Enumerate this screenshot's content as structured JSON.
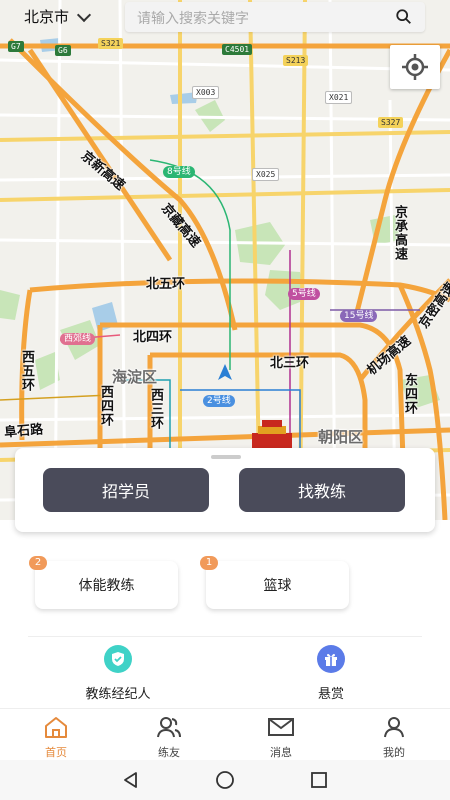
{
  "header": {
    "city": "北京市",
    "search_placeholder": "请输入搜索关键字"
  },
  "map": {
    "road_labels": {
      "jingxin": "京新高速",
      "jingzang": "京藏高速",
      "jingcheng": "京承高速",
      "jingmi": "京密高速",
      "jichang": "机场高速",
      "north5": "北五环",
      "north4": "北四环",
      "north3": "北三环",
      "west5": "西五环",
      "west4": "西四环",
      "west3": "西三环",
      "east4": "东四环",
      "fushi": "阜石路"
    },
    "district_labels": {
      "haidian": "海淀区",
      "chaoyang": "朝阳区"
    },
    "road_badges": {
      "g7": "G7",
      "g6": "G6",
      "s321": "S321",
      "c4501": "C4501",
      "s213": "S213",
      "x003": "X003",
      "x021": "X021",
      "s327": "S327",
      "x025": "X025",
      "g6_right": "G6"
    },
    "metro_badges": {
      "line8": "8号线",
      "line5": "5号线",
      "line15": "15号线",
      "xijiao": "西郊线",
      "line2": "2号线"
    }
  },
  "actions": {
    "recruit_label": "招学员",
    "find_coach_label": "找教练"
  },
  "categories": [
    {
      "label": "体能教练",
      "count": "2"
    },
    {
      "label": "篮球",
      "count": "1"
    }
  ],
  "quick_links": {
    "agent_label": "教练经纪人",
    "reward_label": "悬赏"
  },
  "tabbar": {
    "home": "首页",
    "friends": "练友",
    "messages": "消息",
    "mine": "我的"
  },
  "colors": {
    "accent": "#e58a3c",
    "button_dark": "#4a4b5a",
    "badge": "#f19a5a",
    "agent_icon": "#3fd2c7",
    "reward_icon": "#5b7be8"
  }
}
